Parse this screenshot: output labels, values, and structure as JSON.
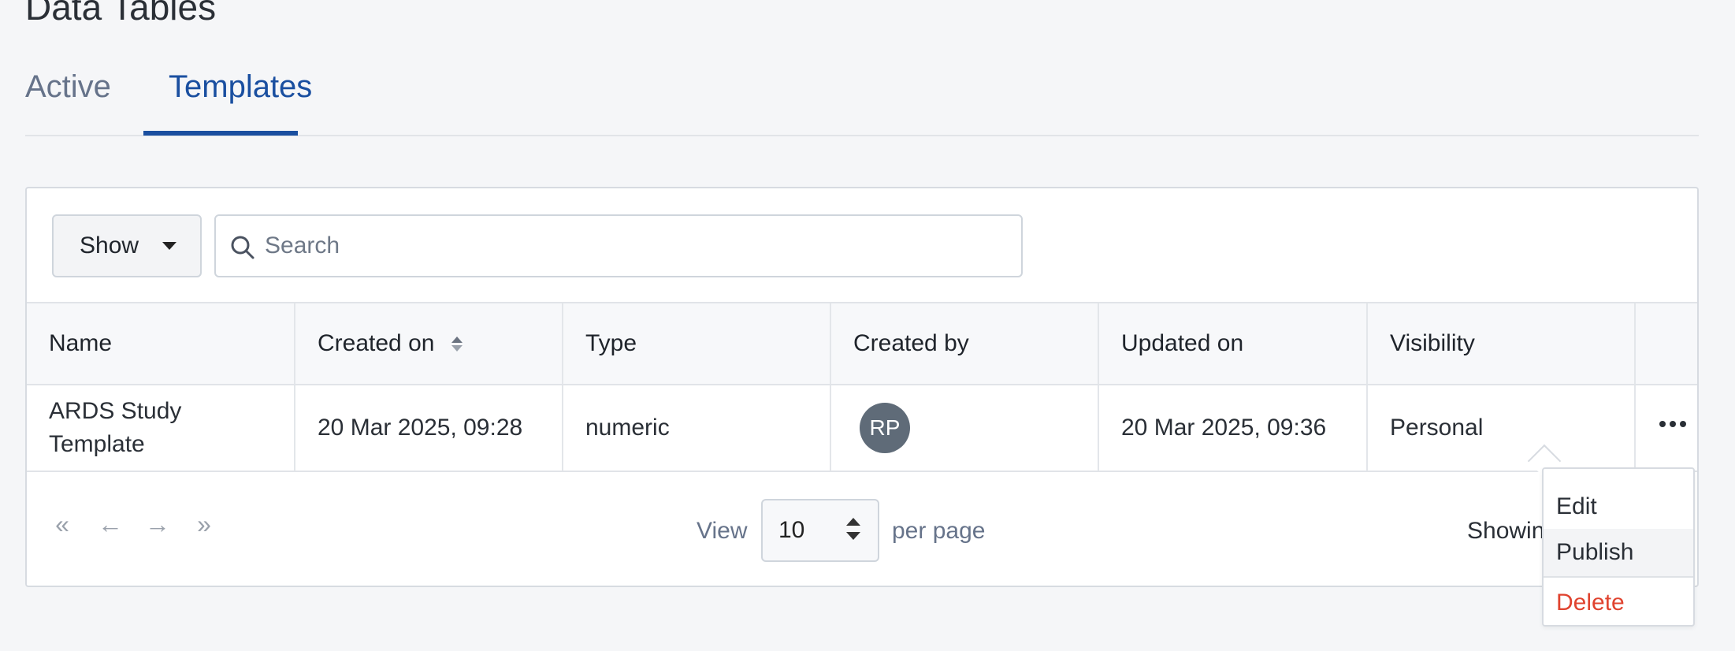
{
  "page": {
    "title": "Data Tables"
  },
  "tabs": [
    {
      "label": "Active",
      "active": false
    },
    {
      "label": "Templates",
      "active": true
    }
  ],
  "toolbar": {
    "show_label": "Show",
    "search_placeholder": "Search"
  },
  "table": {
    "columns": [
      "Name",
      "Created on",
      "Type",
      "Created by",
      "Updated on",
      "Visibility",
      ""
    ],
    "sorted_column": "Created on",
    "rows": [
      {
        "name_line1": "ARDS Study",
        "name_line2": "Template",
        "created_on": "20 Mar 2025, 09:28",
        "type": "numeric",
        "created_by_initials": "RP",
        "updated_on": "20 Mar 2025, 09:36",
        "visibility": "Personal"
      }
    ]
  },
  "pagination": {
    "first": "«",
    "prev": "←",
    "next": "→",
    "last": "»",
    "view_label": "View",
    "per_page_value": "10",
    "per_page_label": "per page",
    "showing_text": "Showin"
  },
  "row_menu": {
    "items": [
      "Edit",
      "Publish",
      "Delete"
    ]
  },
  "colors": {
    "accent": "#1a4fa0",
    "danger": "#e0432f",
    "avatar": "#5f6b78"
  }
}
